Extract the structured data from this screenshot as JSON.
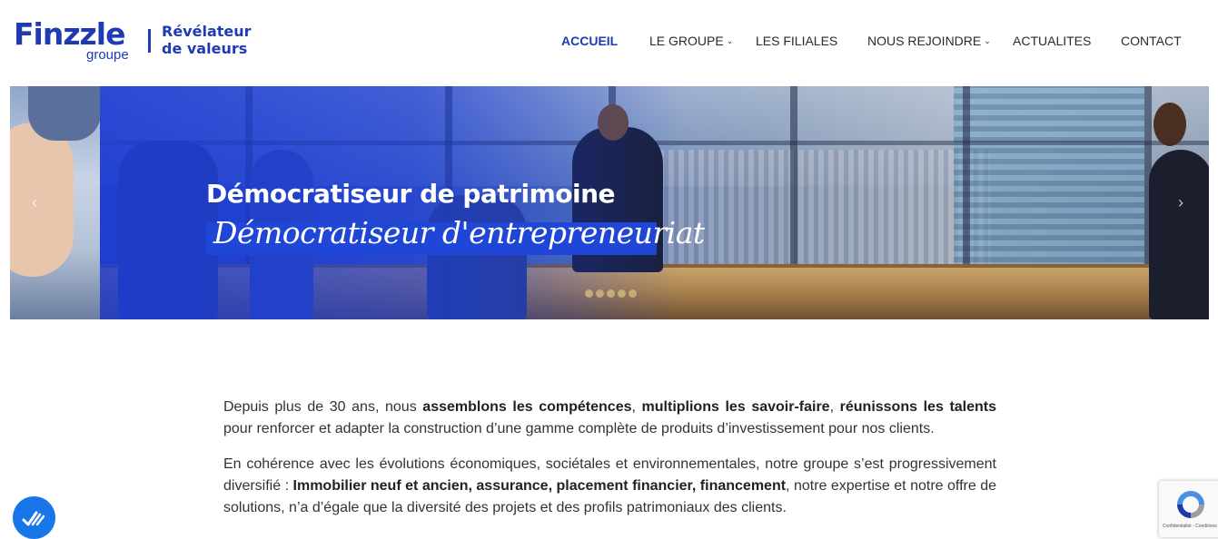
{
  "header": {
    "logo": {
      "brand": "Finzzle",
      "sub": "groupe",
      "tagline_line1": "Révélateur",
      "tagline_line2": "de valeurs"
    },
    "nav": [
      {
        "label": "ACCUEIL",
        "active": true,
        "dropdown": false
      },
      {
        "label": "LE GROUPE",
        "active": false,
        "dropdown": true
      },
      {
        "label": "LES FILIALES",
        "active": false,
        "dropdown": false
      },
      {
        "label": "NOUS REJOINDRE",
        "active": false,
        "dropdown": true
      },
      {
        "label": "ACTUALITES",
        "active": false,
        "dropdown": false
      },
      {
        "label": "CONTACT",
        "active": false,
        "dropdown": false
      }
    ]
  },
  "hero": {
    "title": "Démocratiseur de patrimoine",
    "script": "Démocratiseur d'entrepreneuriat",
    "prev_icon": "chevron-left-icon",
    "next_icon": "chevron-right-icon",
    "slide_count": 5
  },
  "content": {
    "p1": {
      "t1": "Depuis plus de 30 ans, nous ",
      "b1": "assemblons les compétences",
      "t2": ", ",
      "b2": "multiplions les savoir-faire",
      "t3": ", ",
      "b3": "réunissons les talents",
      "t4": " pour renforcer et adapter la construction d’une gamme complète de produits d’investissement pour nos clients."
    },
    "p2": {
      "t1": "En cohérence avec les évolutions économiques, sociétales et environnementales, notre groupe s’est progressivement diversifié : ",
      "b1": "Immobilier neuf et ancien, assurance, placement financier, financement",
      "t2": ", notre expertise et notre offre de solutions, n’a d’égale que la diversité des projets et des profils patrimoniaux des clients."
    }
  },
  "widgets": {
    "accessibility_icon": "accessibility-icon",
    "recaptcha_text": "Confidentialité - Conditions"
  },
  "colors": {
    "brand": "#1e3bb3",
    "accessibility": "#1876e8"
  }
}
